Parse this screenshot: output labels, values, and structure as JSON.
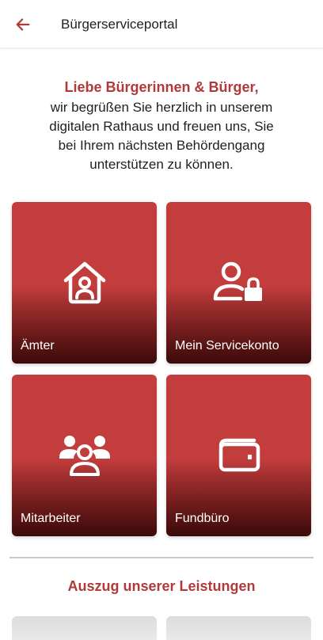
{
  "appbar": {
    "title": "Bürgerserviceportal",
    "back_icon": "arrow-left-icon"
  },
  "welcome": {
    "heading": "Liebe Bürgerinnen & Bürger,",
    "line1": "wir begrüßen Sie herzlich in unserem",
    "line2": "digitalen Rathaus und freuen uns, Sie",
    "line3": "bei Ihrem nächsten Behördengang",
    "line4": "unterstützen zu können."
  },
  "tiles": [
    {
      "label": "Ämter",
      "icon": "house-person-icon"
    },
    {
      "label": "Mein Servicekonto",
      "icon": "user-lock-icon"
    },
    {
      "label": "Mitarbeiter",
      "icon": "group-icon"
    },
    {
      "label": "Fundbüro",
      "icon": "wallet-icon"
    }
  ],
  "section": {
    "title": "Auszug unserer Leistungen"
  },
  "colors": {
    "accent": "#b03a3a",
    "tile_top": "#c43d3d",
    "tile_bottom": "#3c0a0a"
  }
}
